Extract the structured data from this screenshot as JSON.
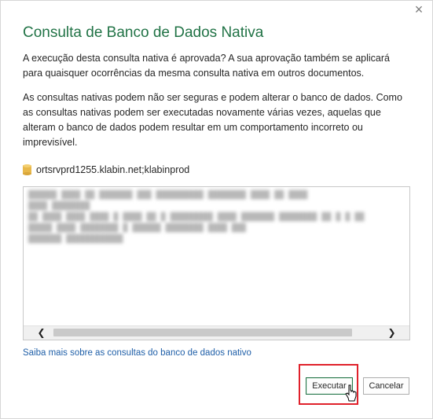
{
  "dialog": {
    "close_glyph": "×",
    "title": "Consulta de Banco de Dados Nativa",
    "paragraph1": "A execução desta consulta nativa é aprovada? A sua aprovação também se aplicará para quaisquer ocorrências da mesma consulta nativa em outros documentos.",
    "paragraph2": "As consultas nativas podem não ser seguras e podem alterar o banco de dados. Como as consultas nativas podem ser executadas novamente várias vezes, aquelas que alteram o banco de dados podem resultar em um comportamento incorreto ou imprevisível.",
    "source": "ortsrvprd1255.klabin.net;klabinprod",
    "learn_more": "Saiba mais sobre as consultas do banco de dados nativo",
    "buttons": {
      "run": "Executar",
      "cancel": "Cancelar"
    },
    "scroll": {
      "left_glyph": "❮",
      "right_glyph": "❯"
    }
  },
  "colors": {
    "title_green": "#217346",
    "link_blue": "#1f5fa8",
    "highlight_red": "#e0212b",
    "db_icon_gold": "#e8b84a"
  },
  "icons": [
    "close-icon",
    "database-icon",
    "scroll-left-icon",
    "scroll-right-icon",
    "mouse-cursor-icon"
  ]
}
